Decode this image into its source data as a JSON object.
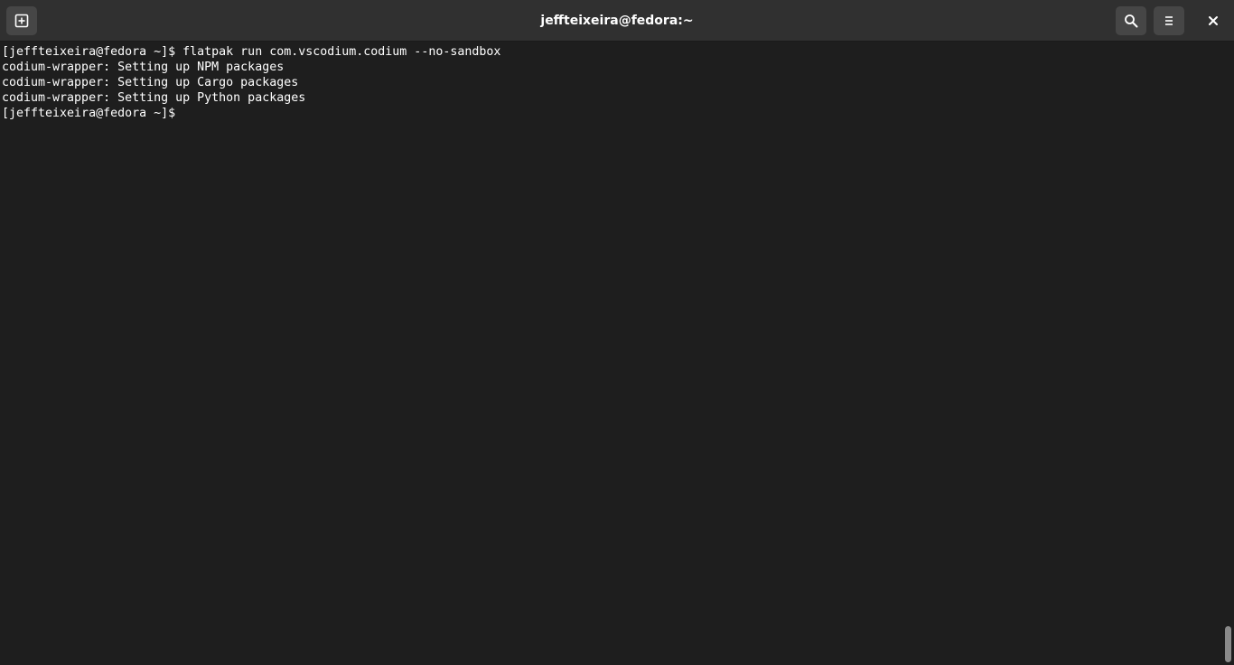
{
  "window": {
    "title": "jeffteixeira@fedora:~"
  },
  "headerbar": {
    "new_tab_icon": "new-tab-icon",
    "search_icon": "search-icon",
    "menu_icon": "hamburger-menu-icon",
    "close_icon": "close-icon"
  },
  "terminal": {
    "lines": [
      "[jeffteixeira@fedora ~]$ flatpak run com.vscodium.codium --no-sandbox",
      "codium-wrapper: Setting up NPM packages",
      "codium-wrapper: Setting up Cargo packages",
      "codium-wrapper: Setting up Python packages",
      "[jeffteixeira@fedora ~]$ "
    ]
  },
  "colors": {
    "headerbar": "#303030",
    "terminal_bg": "#1e1e1e",
    "text": "#ffffff",
    "button_bg": "#464646"
  }
}
